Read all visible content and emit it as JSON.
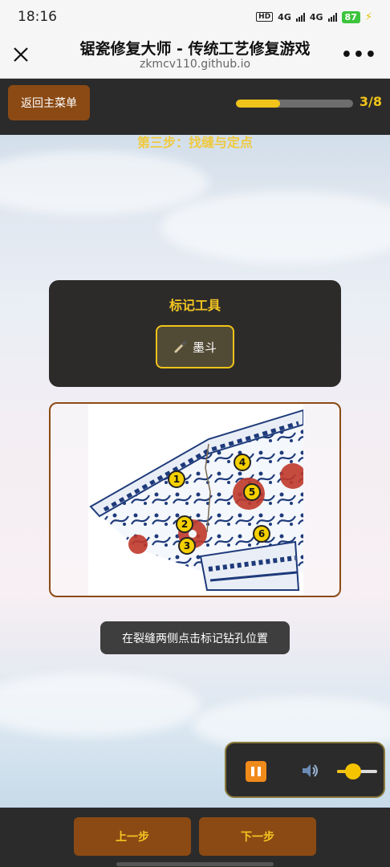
{
  "status_bar": {
    "time": "18:16",
    "hd_badge": "HD",
    "network_1": "4G",
    "network_2": "4G",
    "battery": "87"
  },
  "browser": {
    "title": "锯瓷修复大师 - 传统工艺修复游戏",
    "url": "zkmcv110.github.io",
    "close_icon": "close-icon",
    "more_icon": "more-icon"
  },
  "game": {
    "back_label": "返回主菜单",
    "progress": {
      "current": 3,
      "total": 8,
      "text": "3/8",
      "fraction": 0.375
    },
    "step_title": "第三步：找缝与定点",
    "tools": {
      "title": "标记工具",
      "tool_label": "墨斗",
      "tool_icon": "brush-icon"
    },
    "markers": [
      "1",
      "2",
      "3",
      "4",
      "5",
      "6"
    ],
    "hint": "在裂缝两侧点击标记钻孔位置",
    "audio": {
      "pause_icon": "pause-icon",
      "speaker_icon": "speaker-icon",
      "volume": 0.4
    },
    "prev_label": "上一步",
    "next_label": "下一步"
  },
  "colors": {
    "accent_gold": "#f0c419",
    "brown": "#8b4a14",
    "panel_dark": "#2b2b2b"
  }
}
